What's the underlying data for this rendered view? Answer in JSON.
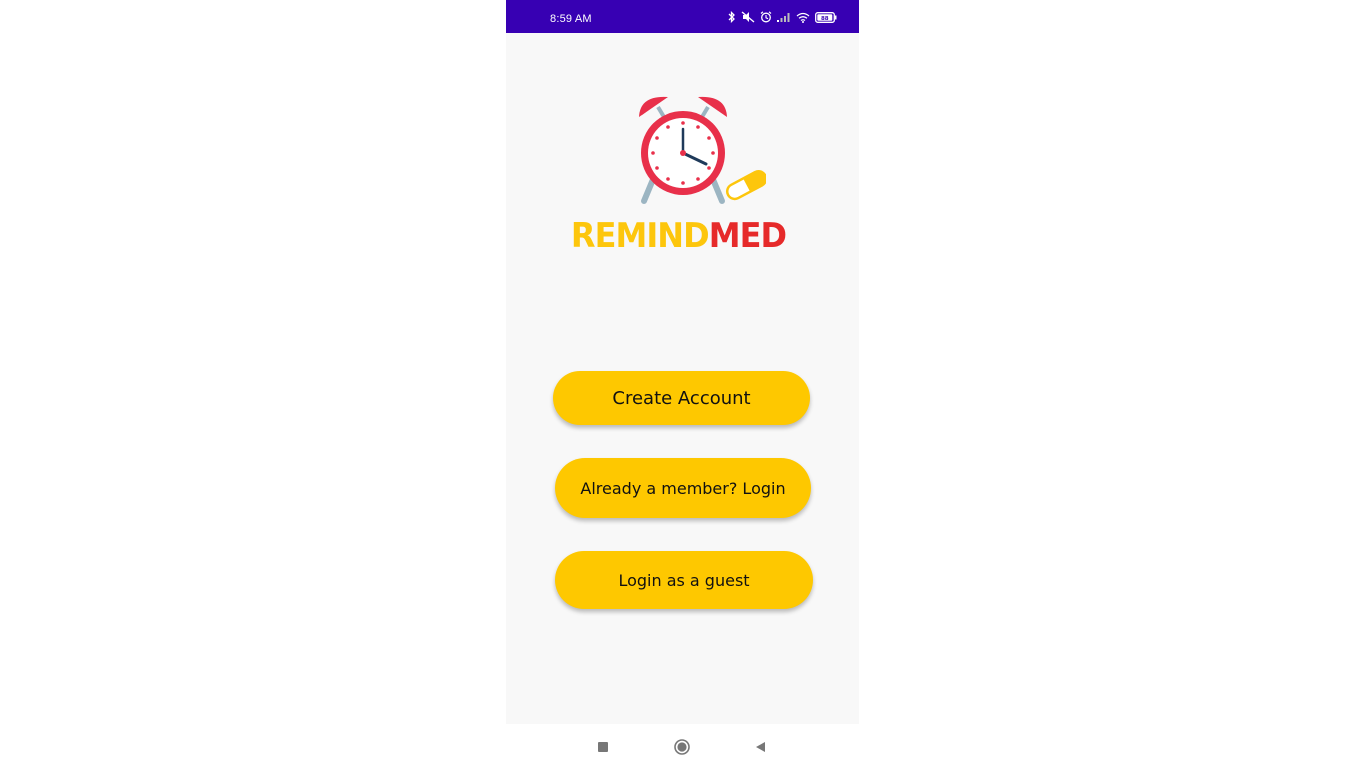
{
  "status_bar": {
    "time": "8:59 AM",
    "icons": [
      "bluetooth-icon",
      "mute-icon",
      "alarm-icon",
      "signal-icon",
      "wifi-icon",
      "battery-icon"
    ],
    "battery_level": "88",
    "color": "#3700b3"
  },
  "logo": {
    "text_part1": "REMIND",
    "text_part2": "MED",
    "color_part1": "#fdc60c",
    "color_part2": "#e62a2a",
    "icon": "alarm-clock-pill-icon"
  },
  "buttons": {
    "create_account": "Create Account",
    "login": "Already a member? Login",
    "guest": "Login as a guest",
    "color": "#fec800"
  },
  "nav_bar": {
    "icons": [
      "recents-icon",
      "home-icon",
      "back-icon"
    ]
  }
}
